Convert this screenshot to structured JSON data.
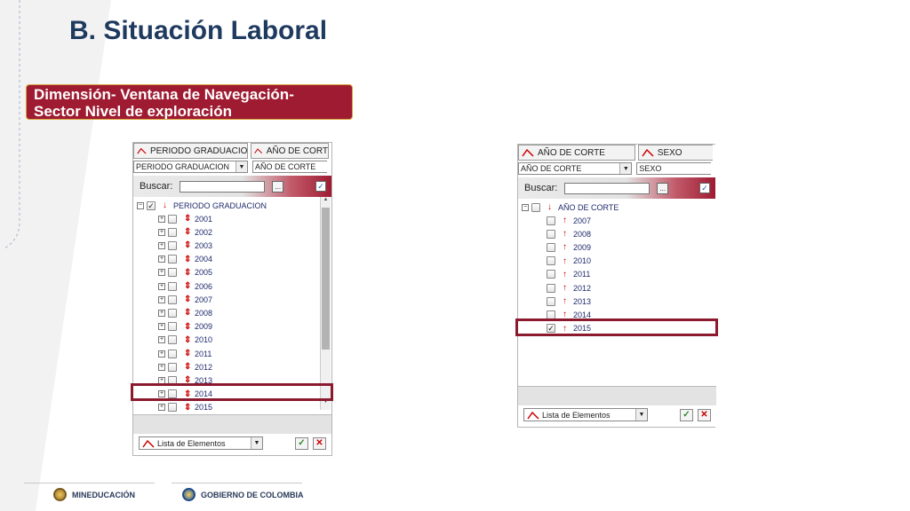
{
  "slide": {
    "title": "B. Situación Laboral",
    "subtitle": "Dimensión- Ventana de Navegación- Sector Nivel de exploración"
  },
  "left_panel": {
    "tabs": [
      "PERIODO GRADUACIO",
      "AÑO DE CORT"
    ],
    "selects": [
      "PERIODO GRADUACION",
      "AÑO DE CORTE"
    ],
    "search_label": "Buscar:",
    "search_value": "",
    "dots_label": "...",
    "root_label": "PERIODO GRADUACION",
    "items": [
      "2001",
      "2002",
      "2003",
      "2004",
      "2005",
      "2006",
      "2007",
      "2008",
      "2009",
      "2010",
      "2011",
      "2012",
      "2013",
      "2014",
      "2015"
    ],
    "highlighted_item": "2014",
    "footer_select": "Lista de Elementos"
  },
  "right_panel": {
    "tabs": [
      "AÑO DE CORTE",
      "SEXO"
    ],
    "selects": [
      "AÑO DE CORTE",
      "SEXO"
    ],
    "search_label": "Buscar:",
    "search_value": "",
    "dots_label": "...",
    "root_label": "AÑO DE CORTE",
    "items": [
      "2007",
      "2008",
      "2009",
      "2010",
      "2011",
      "2012",
      "2013",
      "2014",
      "2015"
    ],
    "checked_item": "2015",
    "footer_select": "Lista de Elementos"
  },
  "logos": {
    "left": "MINEDUCACIÓN",
    "right": "GOBIERNO DE COLOMBIA"
  },
  "colors": {
    "title": "#1f3a5f",
    "accent": "#9e1b32",
    "highlight": "#8c1a2e"
  }
}
